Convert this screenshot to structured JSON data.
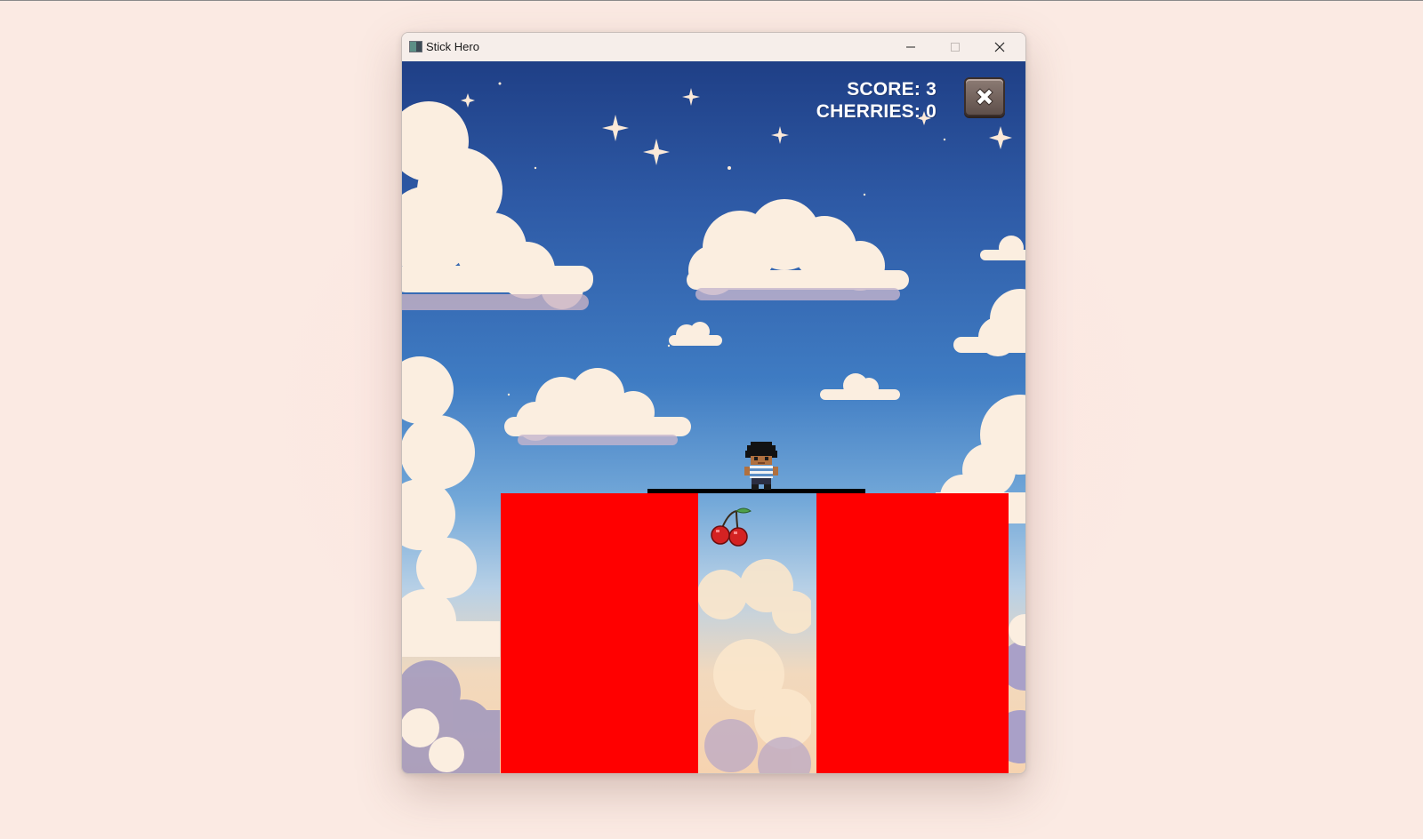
{
  "window": {
    "title": "Stick Hero",
    "app_icon": "app-icon",
    "controls": [
      "minimize-icon",
      "maximize-icon",
      "close-icon"
    ]
  },
  "hud": {
    "score_text": "SCORE: 3",
    "cherries_text": "CHERRIES: 0",
    "close_button_icon": "close-icon"
  },
  "game": {
    "score": 3,
    "cherries": 0,
    "pillar_color": "#ff0000",
    "stick_color": "#000000",
    "sprites": [
      "hero-character",
      "cherry"
    ]
  }
}
